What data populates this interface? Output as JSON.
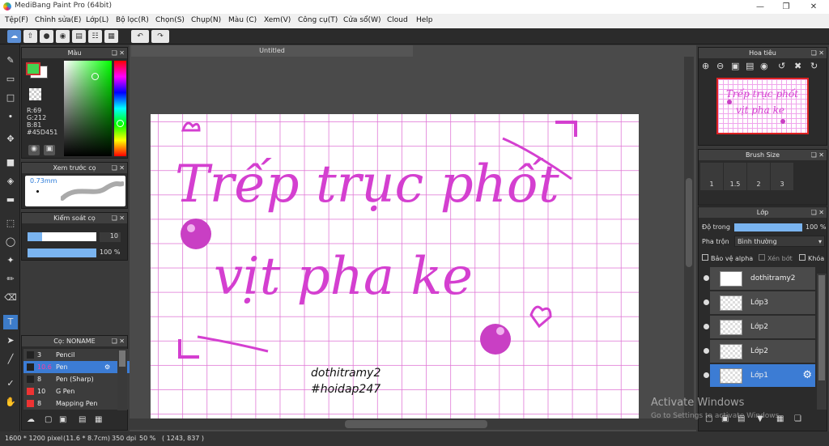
{
  "app": {
    "title": "MediBang Paint Pro (64bit)"
  },
  "menu": [
    "Tệp(F)",
    "Chỉnh sửa(E)",
    "Lớp(L)",
    "Bộ lọc(R)",
    "Chọn(S)",
    "Chụp(N)",
    "Màu (C)",
    "Xem(V)",
    "Công cụ(T)",
    "Cửa sổ(W)",
    "Cloud",
    "Help"
  ],
  "document": {
    "tab": "Untitled"
  },
  "color_panel": {
    "title": "Màu",
    "r": "R:69",
    "g": "G:212",
    "b": "B:81",
    "hex": "#45D451",
    "fg": "#45d451"
  },
  "brush_preview": {
    "title": "Xem trước cọ",
    "size": "0.73mm"
  },
  "brush_control": {
    "title": "Kiểm soát cọ",
    "size": "10",
    "opacity": "100 %"
  },
  "brush_list": {
    "title": "Cọ: NONAME",
    "items": [
      {
        "size": "3",
        "name": "Pencil"
      },
      {
        "size": "10.6",
        "name": "Pen"
      },
      {
        "size": "8",
        "name": "Pen (Sharp)"
      },
      {
        "size": "10",
        "name": "G Pen"
      },
      {
        "size": "8",
        "name": "Mapping Pen"
      }
    ]
  },
  "navigator": {
    "title": "Hoa tiêu"
  },
  "brush_size": {
    "title": "Brush Size",
    "values": [
      "1",
      "1.5",
      "2",
      "3"
    ]
  },
  "layers_panel": {
    "title": "Lớp",
    "opacity_label": "Độ trong",
    "opacity_value": "100 %",
    "blend_label": "Pha trộn",
    "blend_value": "Bình thường",
    "protect_alpha": "Bảo vệ alpha",
    "clip": "Xén bớt",
    "lock": "Khóa",
    "layers": [
      "dothitramy2",
      "Lớp3",
      "Lớp2",
      "Lớp2",
      "Lớp1"
    ]
  },
  "canvas_text": {
    "line1": "Trếp trục phốt",
    "line2": "vịt pha ke",
    "sig1": "dothitramy2",
    "sig2": "#hoidap247"
  },
  "watermark": {
    "title": "Activate Windows",
    "sub": "Go to Settings to activate Windows."
  },
  "status": {
    "size": "1600 * 1200 pixel",
    "cm": "(11.6 * 8.7cm)",
    "dpi": "350 dpi",
    "zoom": "50 %",
    "coord": "( 1243, 837 )"
  }
}
